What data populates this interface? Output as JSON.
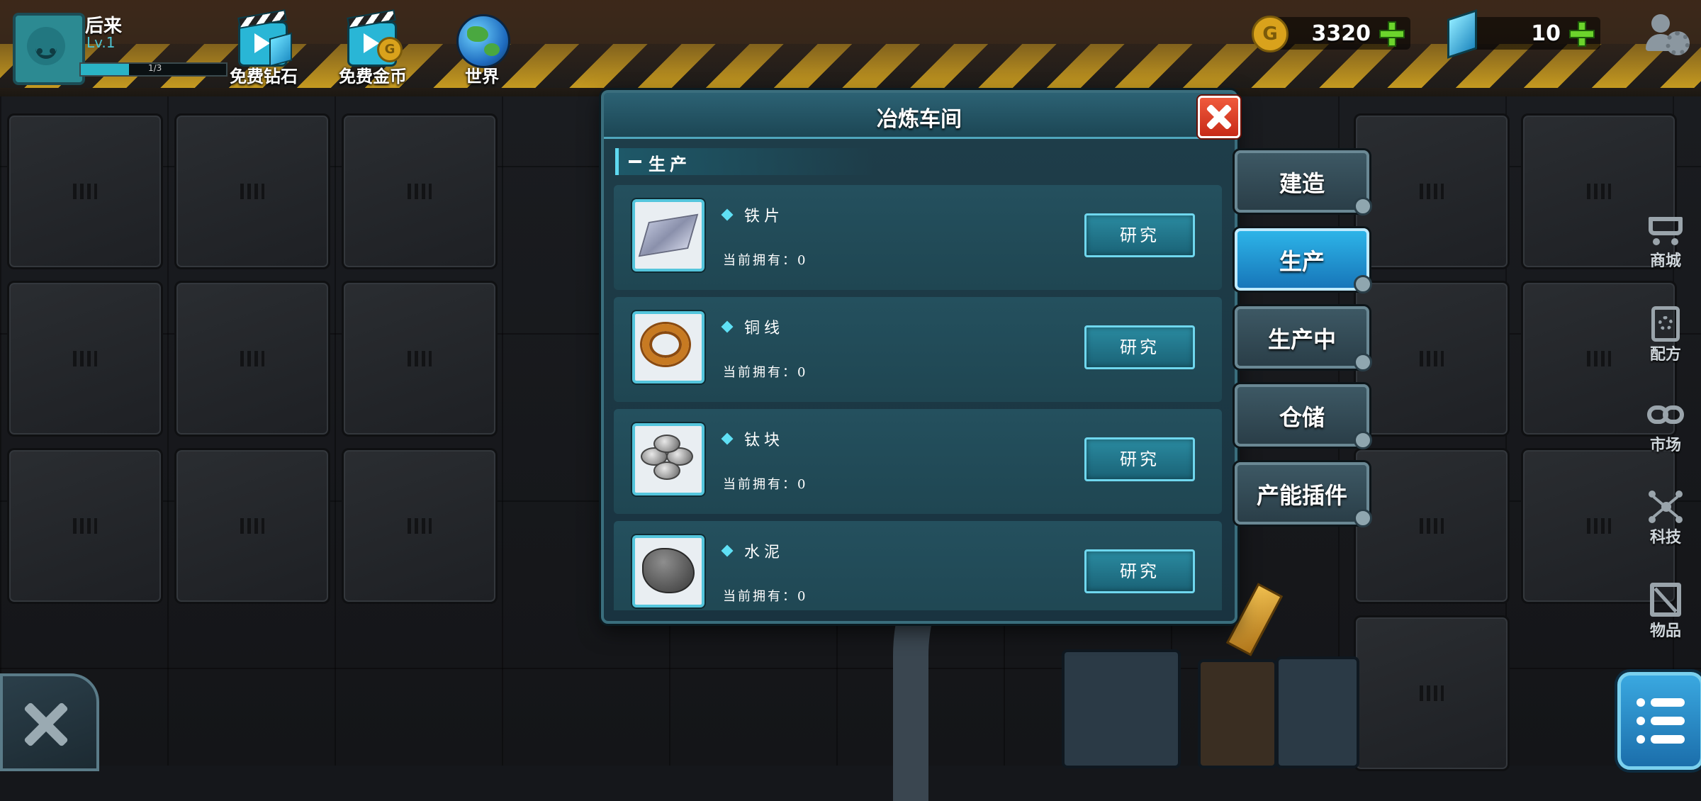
{
  "player": {
    "name": "后来",
    "level": "Lv.1",
    "xp_text": "1/3",
    "xp_progress": 0.33
  },
  "top_nav": [
    {
      "label": "免费钻石",
      "icon": "video-diamond-icon"
    },
    {
      "label": "免费金币",
      "icon": "video-coin-icon"
    },
    {
      "label": "世界",
      "icon": "globe-icon"
    }
  ],
  "resources": {
    "gold": {
      "value": "3320",
      "icon": "gold-coin-icon",
      "coin_letter": "G"
    },
    "diamond": {
      "value": "10",
      "icon": "blue-crystal-icon"
    }
  },
  "dialog": {
    "title": "冶炼车间",
    "section_label": "生产",
    "items": [
      {
        "name": "铁片",
        "owned": "当前拥有：0",
        "button": "研究",
        "icon": "iron-sheet-icon"
      },
      {
        "name": "铜线",
        "owned": "当前拥有：0",
        "button": "研究",
        "icon": "copper-wire-icon"
      },
      {
        "name": "钛块",
        "owned": "当前拥有：0",
        "button": "研究",
        "icon": "titanium-block-icon"
      },
      {
        "name": "水泥",
        "owned": "当前拥有：0",
        "button": "研究",
        "icon": "cement-icon"
      }
    ]
  },
  "side_tabs": [
    {
      "label": "建造",
      "active": false
    },
    {
      "label": "生产",
      "active": true
    },
    {
      "label": "生产中",
      "active": false
    },
    {
      "label": "仓储",
      "active": false
    },
    {
      "label": "产能插件",
      "active": false
    }
  ],
  "right_menu": [
    {
      "label": "商城",
      "icon": "cart-icon"
    },
    {
      "label": "配方",
      "icon": "recipe-gear-icon"
    },
    {
      "label": "市场",
      "icon": "market-link-icon"
    },
    {
      "label": "科技",
      "icon": "tech-nodes-icon"
    },
    {
      "label": "物品",
      "icon": "crate-icon"
    }
  ],
  "colors": {
    "accent": "#2ab3c5",
    "hazard_yellow": "#e6b422",
    "close_red": "#d83a22",
    "plus_green": "#6cd42c",
    "active_tab": "#2db4e8"
  }
}
